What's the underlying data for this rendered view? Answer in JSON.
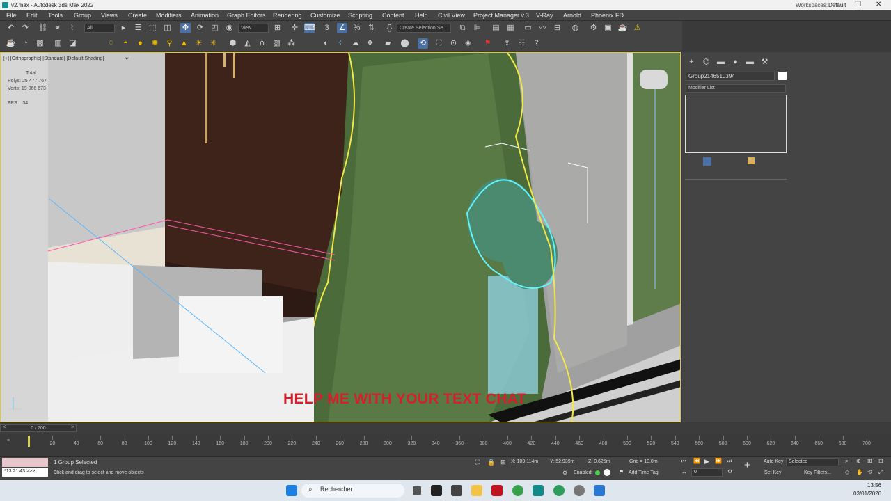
{
  "window": {
    "title": "v2.max - Autodesk 3ds Max 2022",
    "workspace_label": "Workspaces:",
    "workspace_value": "Default"
  },
  "menu": [
    "File",
    "Edit",
    "Tools",
    "Group",
    "Views",
    "Create",
    "Modifiers",
    "Animation",
    "Graph Editors",
    "Rendering",
    "Customize",
    "Scripting",
    "Content",
    "Help",
    "Civil View",
    "Project Manager v.3",
    "V-Ray",
    "Arnold",
    "Phoenix FD"
  ],
  "toolbar": {
    "filter": "All",
    "view": "View",
    "selection_set": "Create Selection Se"
  },
  "viewport": {
    "label": "[+] [Orthographic] [Standard] [Default Shading]",
    "stats_title": "Total",
    "polys_label": "Polys:",
    "polys_value": "25 477 767",
    "verts_label": "Verts:",
    "verts_value": "19 066 673",
    "fps_label": "FPS:",
    "fps_value": "34",
    "overlay_text": "HELP ME WITH YOUR TEXT CHAT",
    "overlay_color": "#d81e2c"
  },
  "command_panel": {
    "object_name": "Group2146510394",
    "modifier_list": "Modifier List"
  },
  "timeline": {
    "frame_display": "0 / 700",
    "ticks": [
      "0",
      "20",
      "40",
      "60",
      "80",
      "100",
      "120",
      "140",
      "160",
      "180",
      "200",
      "220",
      "240",
      "260",
      "280",
      "300",
      "320",
      "340",
      "360",
      "380",
      "400",
      "420",
      "440",
      "460",
      "480",
      "500",
      "520",
      "540",
      "560",
      "580",
      "600",
      "620",
      "640",
      "660",
      "680",
      "700"
    ]
  },
  "status": {
    "maxscript": "*13:21:43 >>>",
    "selection": "1 Group Selected",
    "prompt": "Click and drag to select and move objects",
    "x_label": "X:",
    "x_value": "109,114m",
    "y_label": "Y:",
    "y_value": "52,939m",
    "z_label": "Z:",
    "z_value": "0,625m",
    "grid": "Grid = 10,0m",
    "enabled": "Enabled:",
    "add_time_tag": "Add Time Tag",
    "auto_key": "Auto Key",
    "selected": "Selected",
    "set_key": "Set Key",
    "key_filters": "Key Filters...",
    "frame": "0"
  },
  "taskbar": {
    "search": "Rechercher",
    "time": "13:56",
    "date": "03/01/2026"
  }
}
